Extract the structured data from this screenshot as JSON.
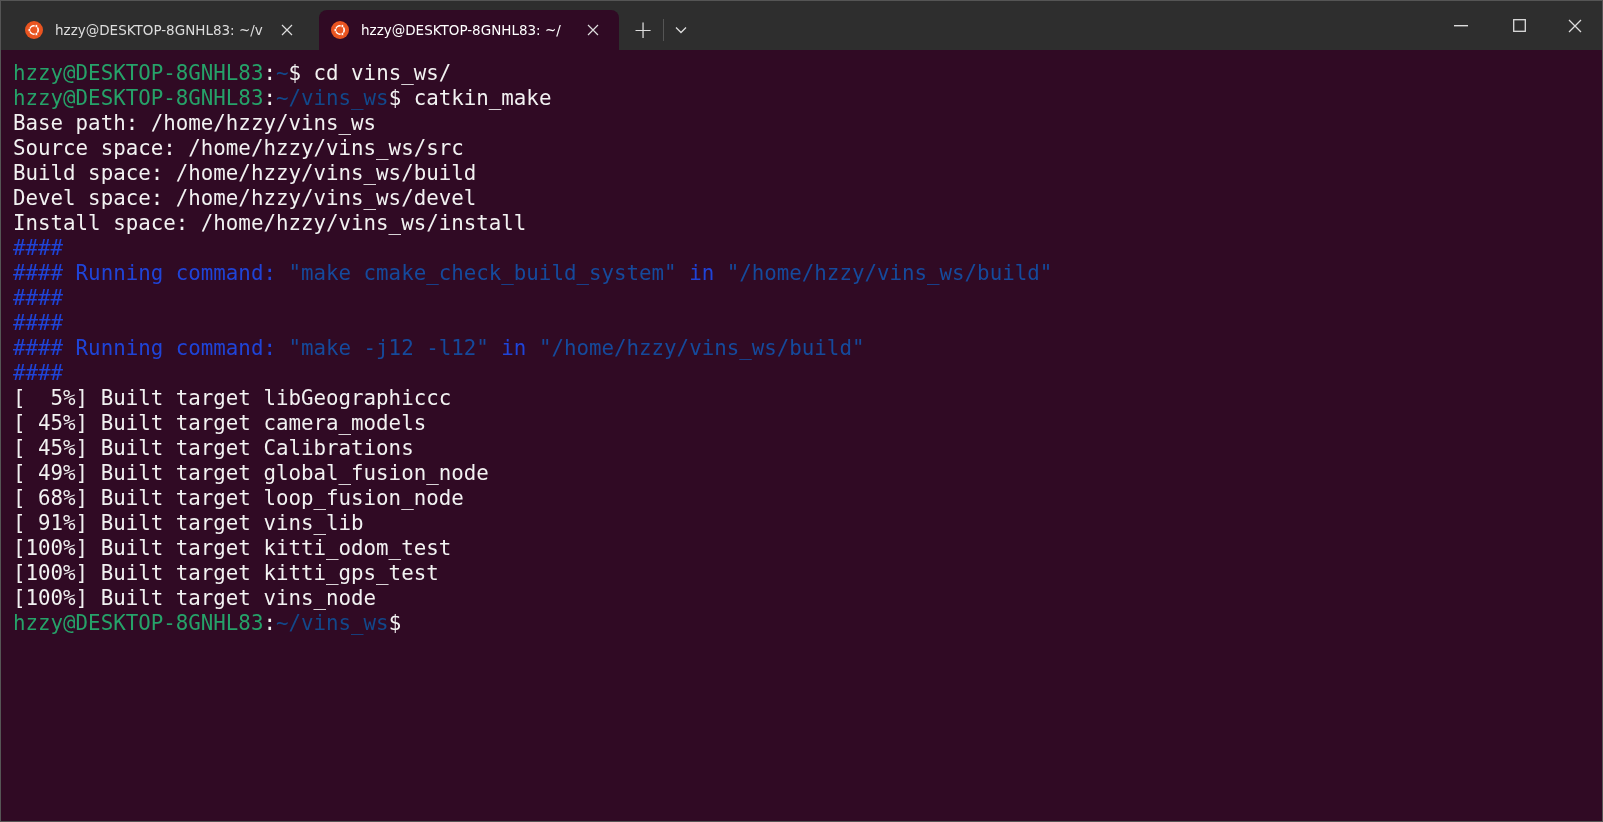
{
  "tabs": [
    {
      "title": "hzzy@DESKTOP-8GNHL83: ~/v",
      "selected": false
    },
    {
      "title": "hzzy@DESKTOP-8GNHL83: ~/",
      "selected": true
    }
  ],
  "new_tab": "+",
  "terminal": {
    "lines": [
      [
        {
          "kind": "user",
          "text": "hzzy@DESKTOP-8GNHL83"
        },
        {
          "kind": "plain",
          "text": ":"
        },
        {
          "kind": "path",
          "text": "~"
        },
        {
          "kind": "plain",
          "text": "$ cd vins_ws/"
        }
      ],
      [
        {
          "kind": "user",
          "text": "hzzy@DESKTOP-8GNHL83"
        },
        {
          "kind": "plain",
          "text": ":"
        },
        {
          "kind": "path",
          "text": "~/vins_ws"
        },
        {
          "kind": "plain",
          "text": "$ catkin_make"
        }
      ],
      [
        {
          "kind": "plain",
          "text": "Base path: /home/hzzy/vins_ws"
        }
      ],
      [
        {
          "kind": "plain",
          "text": "Source space: /home/hzzy/vins_ws/src"
        }
      ],
      [
        {
          "kind": "plain",
          "text": "Build space: /home/hzzy/vins_ws/build"
        }
      ],
      [
        {
          "kind": "plain",
          "text": "Devel space: /home/hzzy/vins_ws/devel"
        }
      ],
      [
        {
          "kind": "plain",
          "text": "Install space: /home/hzzy/vins_ws/install"
        }
      ],
      [
        {
          "kind": "keyword",
          "text": "####"
        }
      ],
      [
        {
          "kind": "keyword",
          "text": "#### Running command:"
        },
        {
          "kind": "string",
          "text": " \"make cmake_check_build_system\""
        },
        {
          "kind": "keyword",
          "text": " in"
        },
        {
          "kind": "string",
          "text": " \"/home/hzzy/vins_ws/build\""
        }
      ],
      [
        {
          "kind": "keyword",
          "text": "####"
        }
      ],
      [
        {
          "kind": "keyword",
          "text": "####"
        }
      ],
      [
        {
          "kind": "keyword",
          "text": "#### Running command:"
        },
        {
          "kind": "string",
          "text": " \"make -j12 -l12\""
        },
        {
          "kind": "keyword",
          "text": " in"
        },
        {
          "kind": "string",
          "text": " \"/home/hzzy/vins_ws/build\""
        }
      ],
      [
        {
          "kind": "keyword",
          "text": "####"
        }
      ],
      [
        {
          "kind": "plain",
          "text": "[  5%] Built target libGeographiccc"
        }
      ],
      [
        {
          "kind": "plain",
          "text": "[ 45%] Built target camera_models"
        }
      ],
      [
        {
          "kind": "plain",
          "text": "[ 45%] Built target Calibrations"
        }
      ],
      [
        {
          "kind": "plain",
          "text": "[ 49%] Built target global_fusion_node"
        }
      ],
      [
        {
          "kind": "plain",
          "text": "[ 68%] Built target loop_fusion_node"
        }
      ],
      [
        {
          "kind": "plain",
          "text": "[ 91%] Built target vins_lib"
        }
      ],
      [
        {
          "kind": "plain",
          "text": "[100%] Built target kitti_odom_test"
        }
      ],
      [
        {
          "kind": "plain",
          "text": "[100%] Built target kitti_gps_test"
        }
      ],
      [
        {
          "kind": "plain",
          "text": "[100%] Built target vins_node"
        }
      ],
      [
        {
          "kind": "user",
          "text": "hzzy@DESKTOP-8GNHL83"
        },
        {
          "kind": "plain",
          "text": ":"
        },
        {
          "kind": "path",
          "text": "~/vins_ws"
        },
        {
          "kind": "plain",
          "text": "$"
        }
      ]
    ]
  }
}
